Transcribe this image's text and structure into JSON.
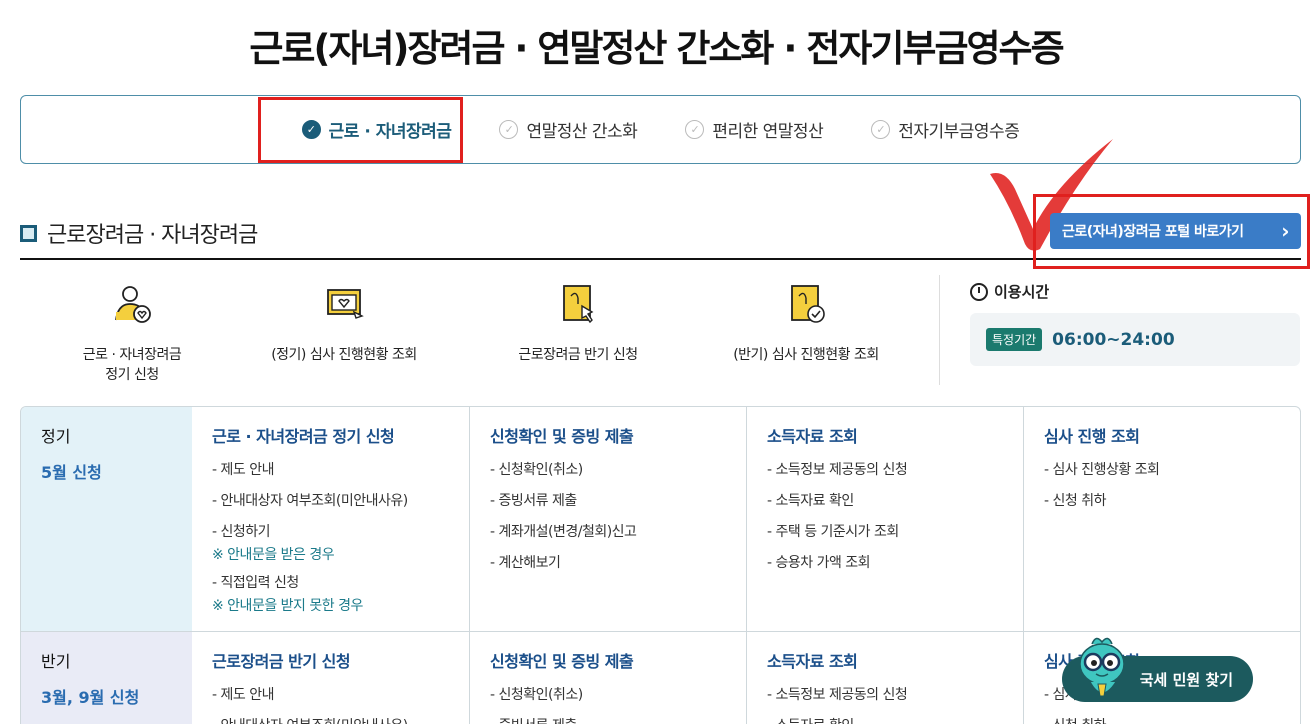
{
  "page_title": "근로(자녀)장려금 · 연말정산 간소화 · 전자기부금영수증",
  "tabs": [
    {
      "label": "근로 · 자녀장려금",
      "active": true
    },
    {
      "label": "연말정산 간소화",
      "active": false
    },
    {
      "label": "편리한 연말정산",
      "active": false
    },
    {
      "label": "전자기부금영수증",
      "active": false
    }
  ],
  "section": {
    "title": "근로장려금 · 자녀장려금",
    "portal_button": "근로(자녀)장려금 포털 바로가기",
    "portal_arrow": "›"
  },
  "quick_menu": [
    {
      "label": "근로 · 자녀장려금\n정기 신청",
      "icon": "person-heart-icon"
    },
    {
      "label": "(정기) 심사 진행현황 조회",
      "icon": "monitor-heart-icon"
    },
    {
      "label": "근로장려금 반기 신청",
      "icon": "document-click-icon"
    },
    {
      "label": "(반기) 심사 진행현황 조회",
      "icon": "document-check-icon"
    }
  ],
  "usage": {
    "title": "이용시간",
    "badge": "특정기간",
    "time": "06:00~24:00"
  },
  "rows": [
    {
      "label": "정기",
      "period": "5월 신청",
      "cols": [
        {
          "head": "근로 · 자녀장려금 정기 신청",
          "items": [
            "- 제도 안내",
            "- 안내대상자 여부조회(미안내사유)",
            "- 신청하기"
          ],
          "note1": "※ 안내문을 받은 경우",
          "item4": "- 직접입력 신청",
          "note2": "※ 안내문을 받지 못한 경우"
        },
        {
          "head": "신청확인 및 증빙 제출",
          "items": [
            "- 신청확인(취소)",
            "- 증빙서류 제출",
            "- 계좌개설(변경/철회)신고",
            "- 계산해보기"
          ]
        },
        {
          "head": "소득자료 조회",
          "items": [
            "- 소득정보 제공동의 신청",
            "- 소득자료 확인",
            "- 주택 등 기준시가 조회",
            "- 승용차 가액 조회"
          ]
        },
        {
          "head": "심사 진행 조회",
          "items": [
            "- 심사 진행상황 조회",
            "- 신청 취하"
          ]
        }
      ]
    },
    {
      "label": "반기",
      "period": "3월, 9월 신청",
      "cols": [
        {
          "head": "근로장려금 반기 신청",
          "items": [
            "- 제도 안내",
            "- 안내대상자 여부조회(미안내사유)"
          ]
        },
        {
          "head": "신청확인 및 증빙 제출",
          "items": [
            "- 신청확인(취소)",
            "- 증빙서류 제출"
          ]
        },
        {
          "head": "소득자료 조회",
          "items": [
            "- 소득정보 제공동의 신청",
            "- 소득자료 확인"
          ]
        },
        {
          "head": "심사 진행 조회",
          "items": [
            "- 심사 진행상황 조회",
            "- 신청 취하"
          ]
        }
      ]
    }
  ],
  "float_button": "국세 민원 찾기",
  "colors": {
    "accent": "#1b5c79",
    "highlight": "#e0201e",
    "button": "#3a7cc7"
  }
}
